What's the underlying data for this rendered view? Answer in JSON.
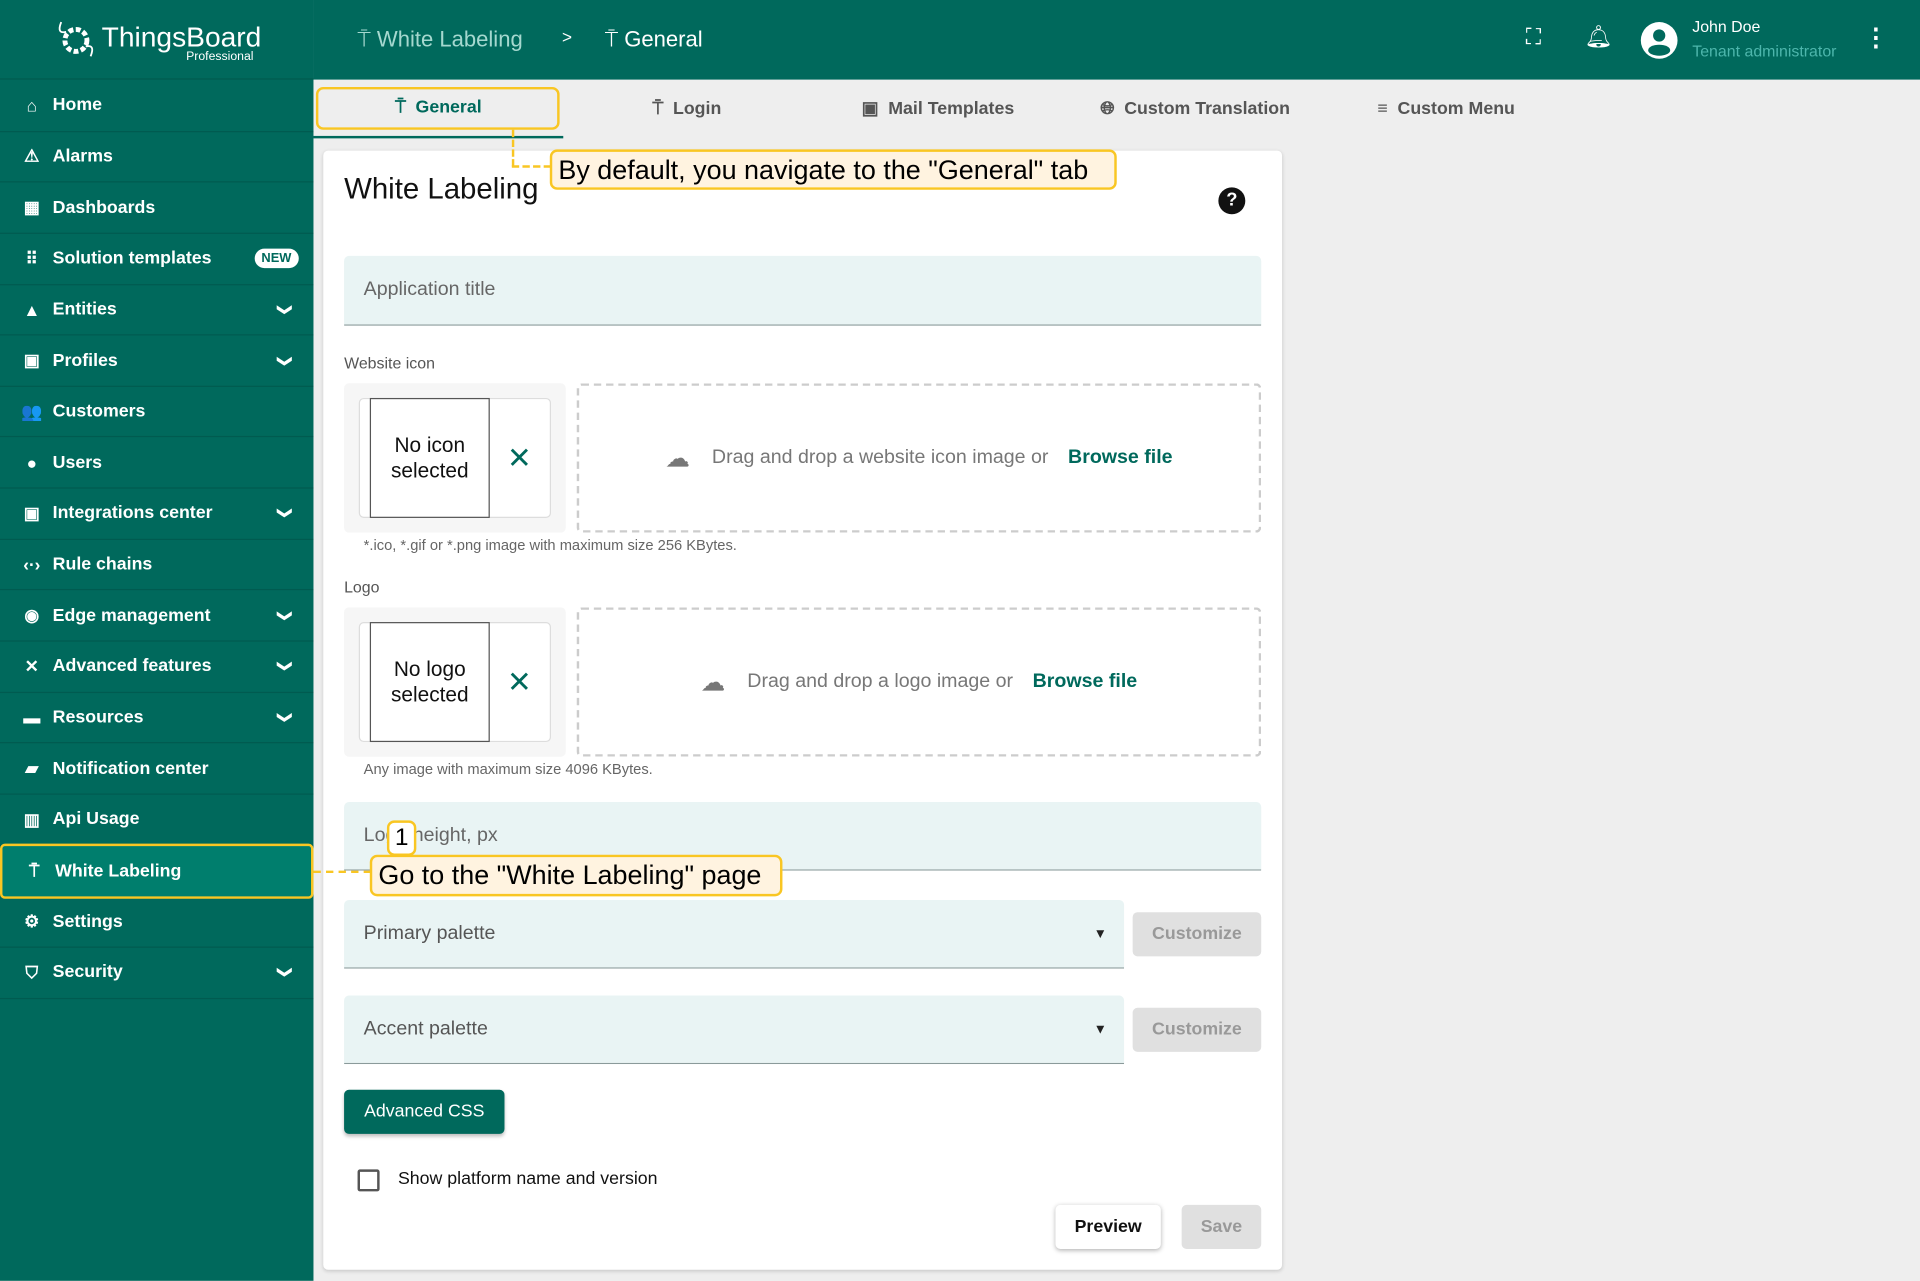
{
  "brand": {
    "name": "ThingsBoard",
    "edition": "Professional"
  },
  "sidebar": {
    "items": [
      {
        "label": "Home",
        "icon": "home-icon",
        "glyph": "⌂"
      },
      {
        "label": "Alarms",
        "icon": "warning-icon",
        "glyph": "⚠"
      },
      {
        "label": "Dashboards",
        "icon": "dashboard-icon",
        "glyph": "▦"
      },
      {
        "label": "Solution templates",
        "icon": "apps-icon",
        "glyph": "⠿",
        "badge": "NEW"
      },
      {
        "label": "Entities",
        "icon": "category-icon",
        "glyph": "▲",
        "expandable": true
      },
      {
        "label": "Profiles",
        "icon": "badge-icon",
        "glyph": "▣",
        "expandable": true
      },
      {
        "label": "Customers",
        "icon": "people-icon",
        "glyph": "👥"
      },
      {
        "label": "Users",
        "icon": "account-circle-icon",
        "glyph": "●"
      },
      {
        "label": "Integrations center",
        "icon": "integration-icon",
        "glyph": "▣",
        "expandable": true
      },
      {
        "label": "Rule chains",
        "icon": "settings-ethernet-icon",
        "glyph": "‹·›"
      },
      {
        "label": "Edge management",
        "icon": "router-icon",
        "glyph": "◉",
        "expandable": true
      },
      {
        "label": "Advanced features",
        "icon": "construction-icon",
        "glyph": "✕",
        "expandable": true
      },
      {
        "label": "Resources",
        "icon": "folder-icon",
        "glyph": "▬",
        "expandable": true
      },
      {
        "label": "Notification center",
        "icon": "notification-icon",
        "glyph": "▰"
      },
      {
        "label": "Api Usage",
        "icon": "insert-chart-icon",
        "glyph": "▥"
      },
      {
        "label": "White Labeling",
        "icon": "format-paint-icon",
        "glyph": "⍑",
        "active": true
      },
      {
        "label": "Settings",
        "icon": "settings-icon",
        "glyph": "⚙"
      },
      {
        "label": "Security",
        "icon": "security-icon",
        "glyph": "⛉",
        "expandable": true
      }
    ]
  },
  "header": {
    "breadcrumb": [
      "White Labeling",
      "General"
    ],
    "separator": ">",
    "user": {
      "name": "John Doe",
      "role": "Tenant administrator"
    }
  },
  "tabs": [
    {
      "label": "General",
      "icon": "format-paint-icon",
      "active": true
    },
    {
      "label": "Login",
      "icon": "format-paint-icon"
    },
    {
      "label": "Mail Templates",
      "icon": "mail-template-icon"
    },
    {
      "label": "Custom Translation",
      "icon": "language-icon"
    },
    {
      "label": "Custom Menu",
      "icon": "list-icon"
    }
  ],
  "form": {
    "title": "White Labeling",
    "app_title_placeholder": "Application title",
    "website_icon": {
      "label": "Website icon",
      "empty": "No icon selected",
      "drop_text": "Drag and drop a website icon image or",
      "browse": "Browse file",
      "hint": "*.ico, *.gif or *.png image with maximum size 256 KBytes."
    },
    "logo": {
      "label": "Logo",
      "empty": "No logo selected",
      "drop_text": "Drag and drop a logo image or",
      "browse": "Browse file",
      "hint": "Any image with maximum size 4096 KBytes."
    },
    "logo_height_placeholder": "Logo height, px",
    "primary_palette": "Primary palette",
    "accent_palette": "Accent palette",
    "customize": "Customize",
    "advanced_css": "Advanced CSS",
    "show_platform": "Show platform name and version",
    "show_platform_checked": false,
    "preview": "Preview",
    "save": "Save"
  },
  "annotations": {
    "tab_callout": "By default, you navigate to the \"General\" tab",
    "step_number": "1",
    "step_callout": "Go to the \"White Labeling\" page"
  },
  "colors": {
    "primary": "#00695c",
    "highlight": "#f9c623",
    "callout_bg": "#fff3e0"
  }
}
